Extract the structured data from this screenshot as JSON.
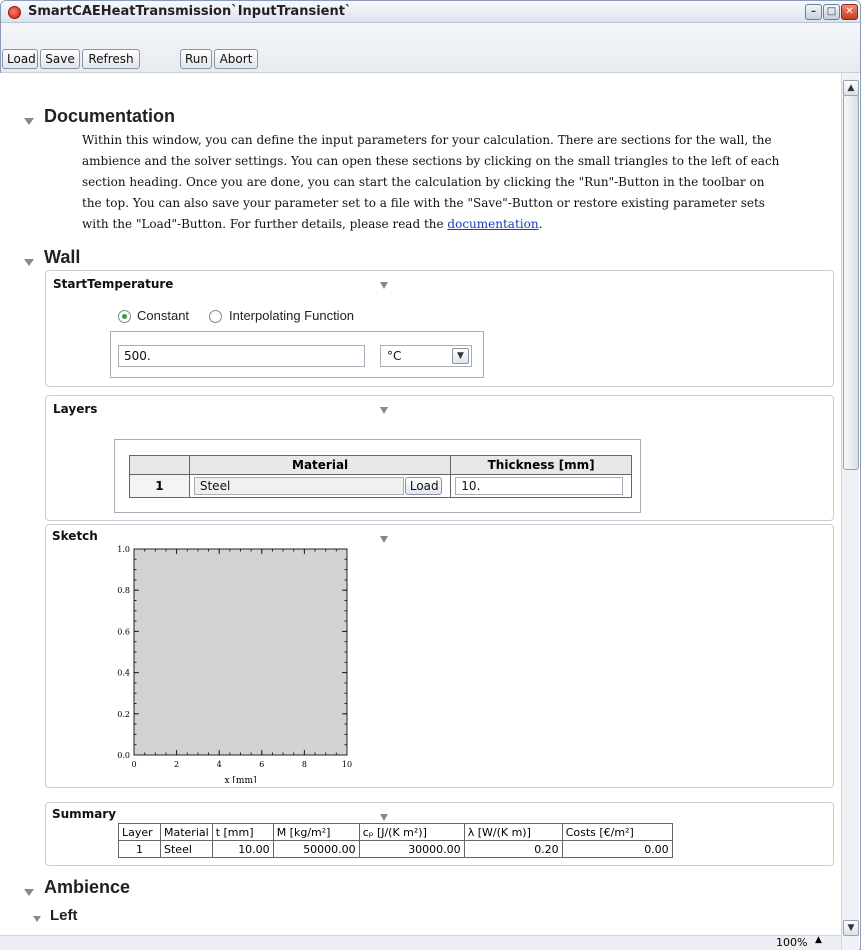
{
  "window": {
    "title": "SmartCAEHeatTransmission`InputTransient`",
    "controls": [
      "–",
      "□",
      "✕"
    ]
  },
  "toolbar": {
    "buttons": [
      "Load",
      "Save",
      "Refresh",
      "Run",
      "Abort"
    ]
  },
  "documentation": {
    "heading": "Documentation",
    "text_before_link": "Within this window, you can define the input parameters for your calculation. There are sections for the wall, the ambience and the solver settings. You can open these sections by clicking on the small triangles to the left of each section heading. Once you are done, you can start the calculation by clicking the \"Run\"-Button in the toolbar on the top. You can also save your parameter set to a file with the \"Save\"-Button or restore existing parameter sets with the \"Load\"-Button. For further details, please read the ",
    "link_text": "documentation",
    "text_after_link": "."
  },
  "wall": {
    "heading": "Wall",
    "start_temperature": {
      "title": "StartTemperature",
      "options": [
        "Constant",
        "Interpolating Function"
      ],
      "selected": "Constant",
      "value": "500.",
      "unit": "°C"
    },
    "layers": {
      "title": "Layers",
      "columns": [
        "Material",
        "Thickness [mm]"
      ],
      "rows": [
        {
          "index": "1",
          "material": "Steel",
          "load_label": "Load",
          "thickness": "10."
        }
      ]
    },
    "sketch": {
      "title": "Sketch"
    },
    "summary": {
      "title": "Summary",
      "columns": [
        "Layer",
        "Material",
        "t [mm]",
        "M [kg/m²]",
        "cₚ [J/(K m²)]",
        "λ [W/(K m)]",
        "Costs [€/m²]"
      ],
      "rows": [
        [
          "1",
          "Steel",
          "10.00",
          "50000.00",
          "30000.00",
          "0.20",
          "0.00"
        ]
      ]
    }
  },
  "ambience": {
    "heading": "Ambience",
    "left_heading": "Left"
  },
  "statusbar": {
    "zoom": "100%"
  },
  "chart_data": {
    "type": "scatter",
    "xlabel": "x [mm]",
    "ylabel": "",
    "xlim": [
      0,
      10
    ],
    "ylim": [
      0,
      1.0
    ],
    "xticks": [
      "0",
      "2",
      "4",
      "6",
      "8",
      "10"
    ],
    "yticks": [
      "0.0",
      "0.2",
      "0.4",
      "0.6",
      "0.8",
      "1.0"
    ],
    "fill": {
      "from_x": 0,
      "to_x": 10,
      "color": "#d3d3d3"
    },
    "series": []
  }
}
